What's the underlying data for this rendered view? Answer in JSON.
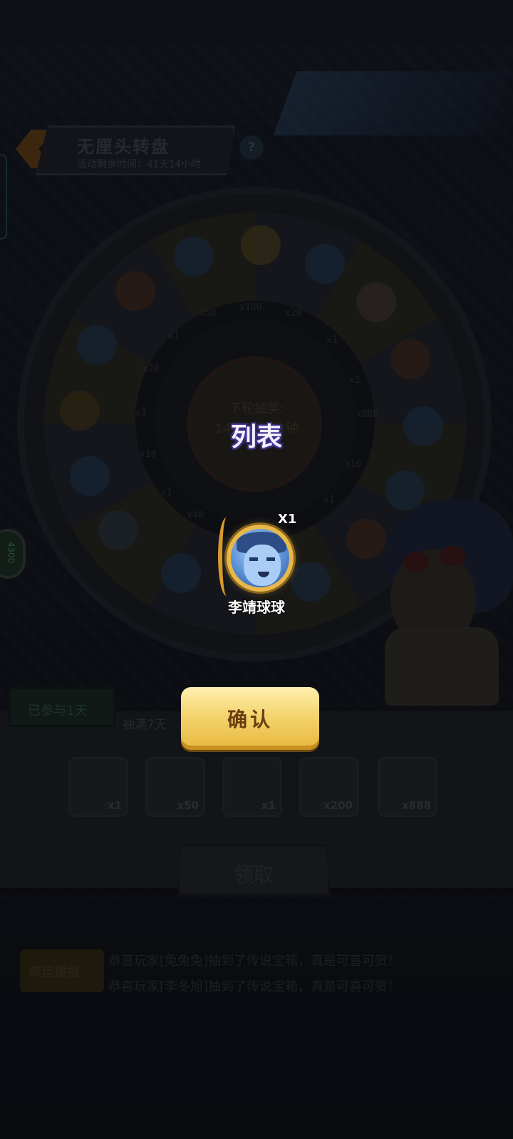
{
  "header": {
    "title": "无厘头转盘",
    "countdown": "活动剩余时间：41天14小时",
    "help_icon": "question-mark-icon"
  },
  "left_badge": {
    "value": "4300"
  },
  "wheel": {
    "segment_labels": [
      "x50",
      "x100",
      "x20",
      "x1",
      "x1",
      "x888",
      "x10",
      "x1",
      "x40",
      "x1",
      "x10",
      "x1",
      "x20",
      "x1"
    ],
    "hub_text_line1": "下轮抽奖:",
    "hub_text_line2": "14小时32分钟"
  },
  "popup": {
    "title": "列表",
    "reward": {
      "icon": "li-jing-ball-avatar",
      "quantity": "X1",
      "name": "李靖球球"
    },
    "confirm_label": "确认"
  },
  "progress": {
    "days_label": "已参与1天",
    "hint": "抽满7天"
  },
  "rewards": [
    {
      "icon": "scroll-icon",
      "qty": "x1"
    },
    {
      "icon": "star-icon",
      "qty": "x50"
    },
    {
      "icon": "hero-avatar-icon",
      "qty": "x1"
    },
    {
      "icon": "blue-star-icon",
      "qty": "x200"
    },
    {
      "icon": "diamond-icon",
      "qty": "x888"
    }
  ],
  "claim_label": "领取",
  "lucky": {
    "tag": "幸运播报",
    "lines": [
      "恭喜玩家[兔兔兔]抽到了传说宝箱，真是可喜可贺！",
      "恭喜玩家[李冬旭]抽到了传说宝箱，真是可喜可贺！"
    ]
  },
  "colors": {
    "confirm_button": "#f4d46e",
    "title_glow": "#3b2c84",
    "avatar_frame": "#e8b94a"
  }
}
